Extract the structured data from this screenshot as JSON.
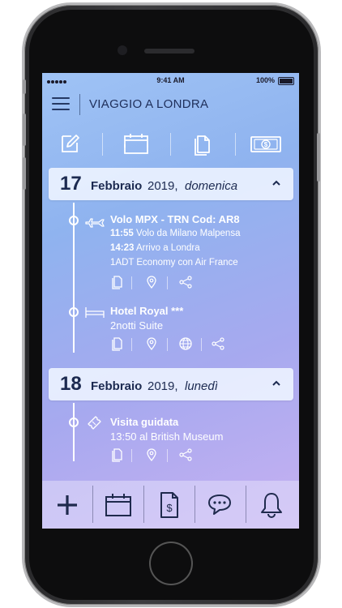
{
  "status": {
    "time": "9:41 AM",
    "battery": "100%"
  },
  "header": {
    "title": "VIAGGIO A LONDRA"
  },
  "toolbar": {
    "items": [
      "edit-icon",
      "calendar-icon",
      "documents-icon",
      "money-icon"
    ]
  },
  "days": [
    {
      "num": "17",
      "month": "Febbraio",
      "year": "2019,",
      "weekday": "domenica",
      "events": [
        {
          "title": "Volo MPX - TRN Cod: AR8",
          "lines": [
            {
              "time": "11:55",
              "text": " Volo da Milano Malpensa"
            },
            {
              "time": "14:23",
              "text": " Arrivo a Londra"
            },
            {
              "time": "",
              "text": "1ADT Economy con Air France"
            }
          ]
        },
        {
          "title": "Hotel Royal ***",
          "subtitle": "2notti Suite"
        }
      ]
    },
    {
      "num": "18",
      "month": "Febbraio",
      "year": "2019,",
      "weekday": "lunedì",
      "events": [
        {
          "title": "Visita guidata",
          "subtitle": "13:50 al British Museum"
        }
      ]
    }
  ],
  "bottom_nav": [
    "add-icon",
    "calendar-icon",
    "invoice-icon",
    "chat-icon",
    "bell-icon"
  ],
  "colors": {
    "accent": "#1f2f5a",
    "header_bg": "#ecf2ff",
    "timeline": "#ffffff"
  }
}
